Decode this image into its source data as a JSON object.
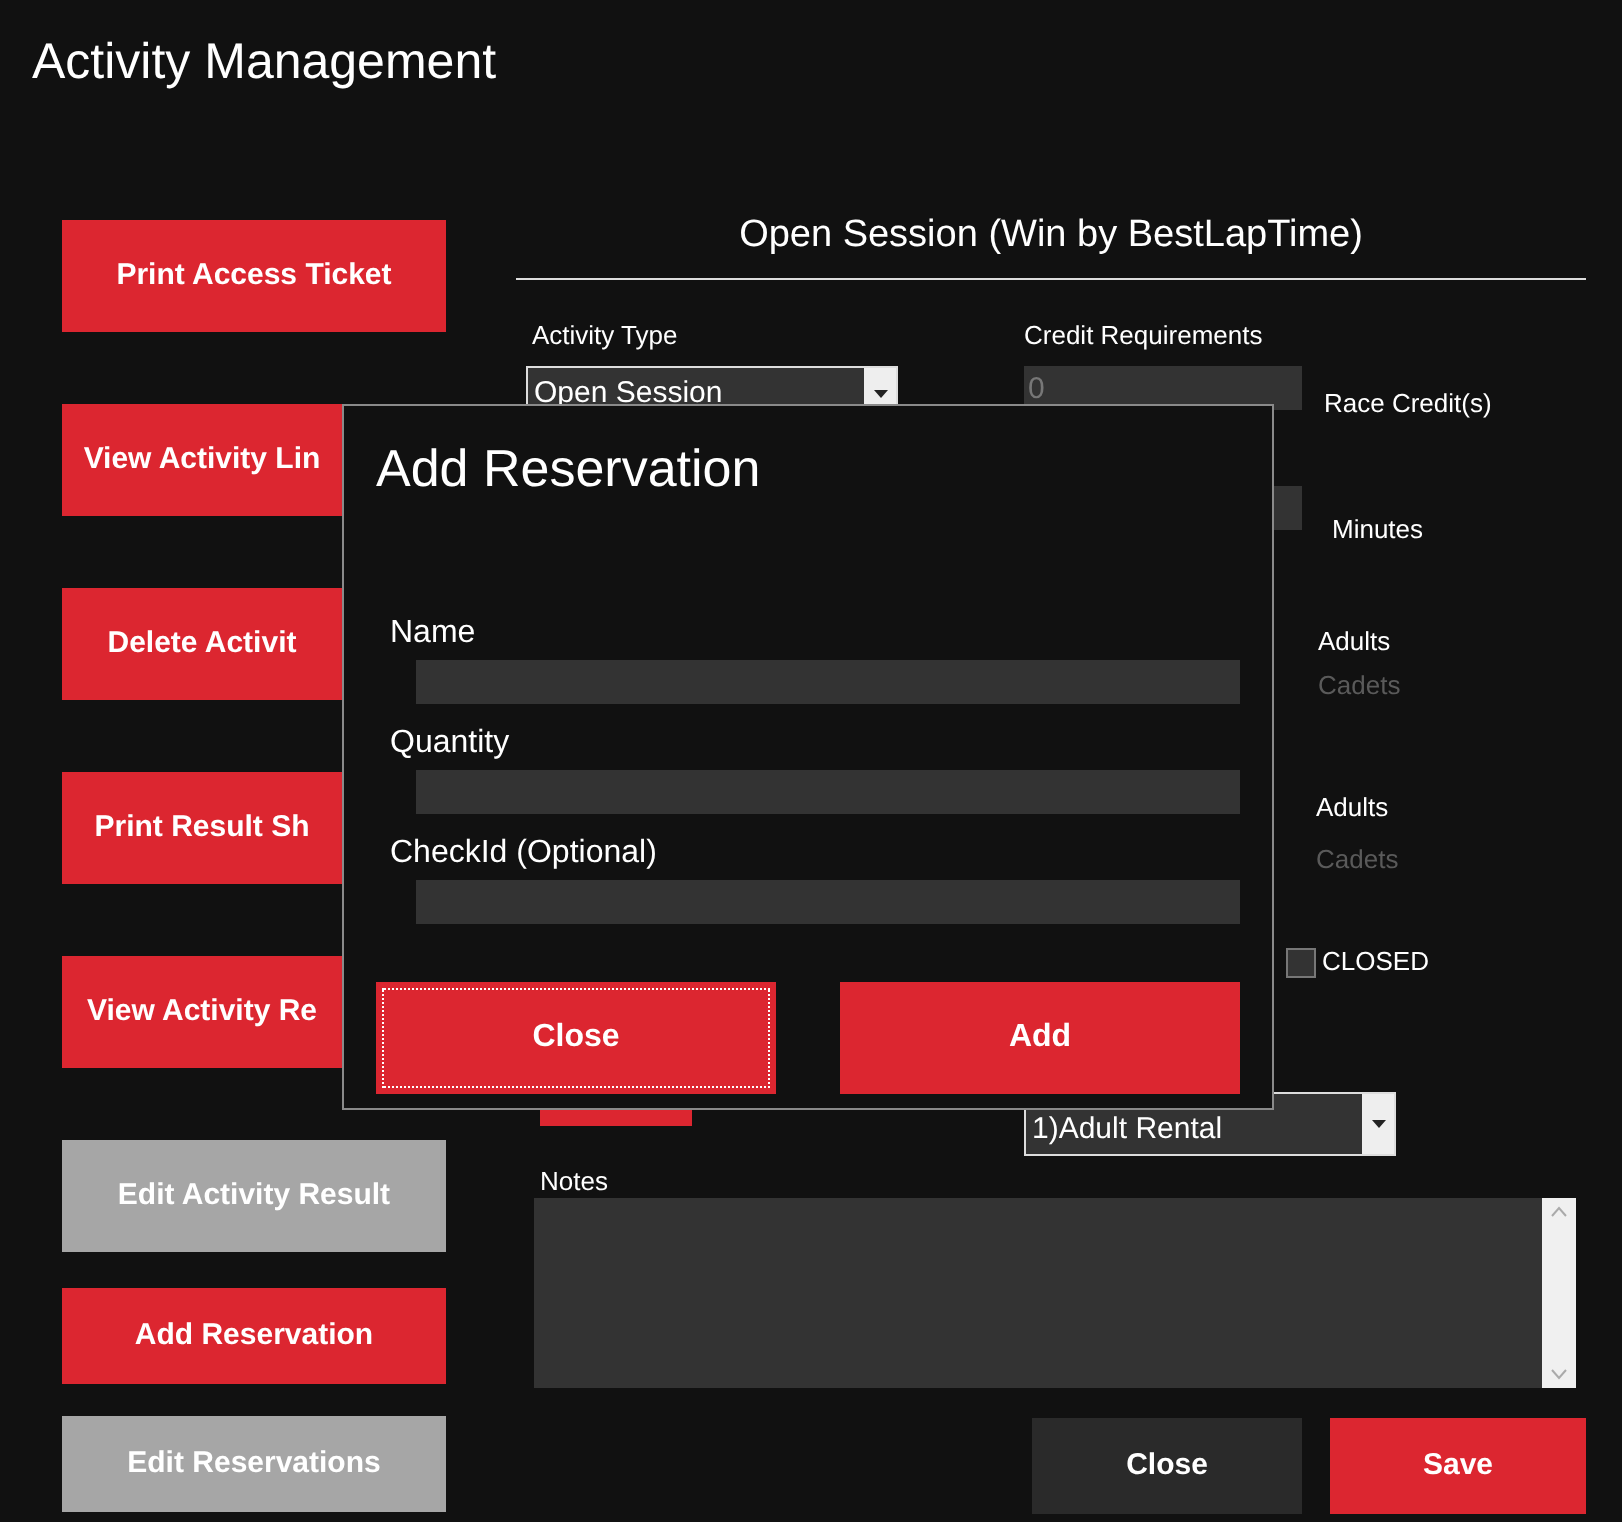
{
  "window": {
    "title": "Activity Management"
  },
  "side_buttons": [
    {
      "label": "Print Access Ticket",
      "disabled": false
    },
    {
      "label": "View Activity Lin",
      "disabled": false
    },
    {
      "label": "Delete Activit",
      "disabled": false
    },
    {
      "label": "Print Result Sh",
      "disabled": false
    },
    {
      "label": "View Activity Re",
      "disabled": false
    },
    {
      "label": "Edit Activity Result",
      "disabled": true
    },
    {
      "label": "Add Reservation",
      "disabled": false
    },
    {
      "label": "Edit Reservations",
      "disabled": true
    }
  ],
  "session": {
    "title": "Open Session (Win by BestLapTime)",
    "activity_type": {
      "label": "Activity Type",
      "value": "Open Session"
    },
    "credit": {
      "label": "Credit Requirements",
      "value": "0",
      "disabled": true,
      "unit": "Race Credit(s)"
    },
    "duration": {
      "unit": "Minutes"
    },
    "groups": [
      {
        "items": [
          {
            "label": "Adults",
            "disabled": false
          },
          {
            "label": "Cadets",
            "disabled": true
          }
        ]
      },
      {
        "items": [
          {
            "label": "Adults",
            "disabled": false
          },
          {
            "label": "Cadets",
            "disabled": true
          }
        ]
      }
    ],
    "closed": {
      "label": "CLOSED",
      "checked": false
    },
    "rental": {
      "value": "1)Adult Rental"
    },
    "notes": {
      "label": "Notes"
    },
    "buttons": [
      {
        "label": "Close",
        "kind": "secondary"
      },
      {
        "label": "Save",
        "kind": "primary"
      }
    ]
  },
  "dialog": {
    "title": "Add Reservation",
    "fields": [
      {
        "label": "Name"
      },
      {
        "label": "Quantity"
      },
      {
        "label": "CheckId (Optional)"
      }
    ],
    "buttons": [
      {
        "label": "Close",
        "focused": true
      },
      {
        "label": "Add",
        "focused": false
      }
    ]
  }
}
